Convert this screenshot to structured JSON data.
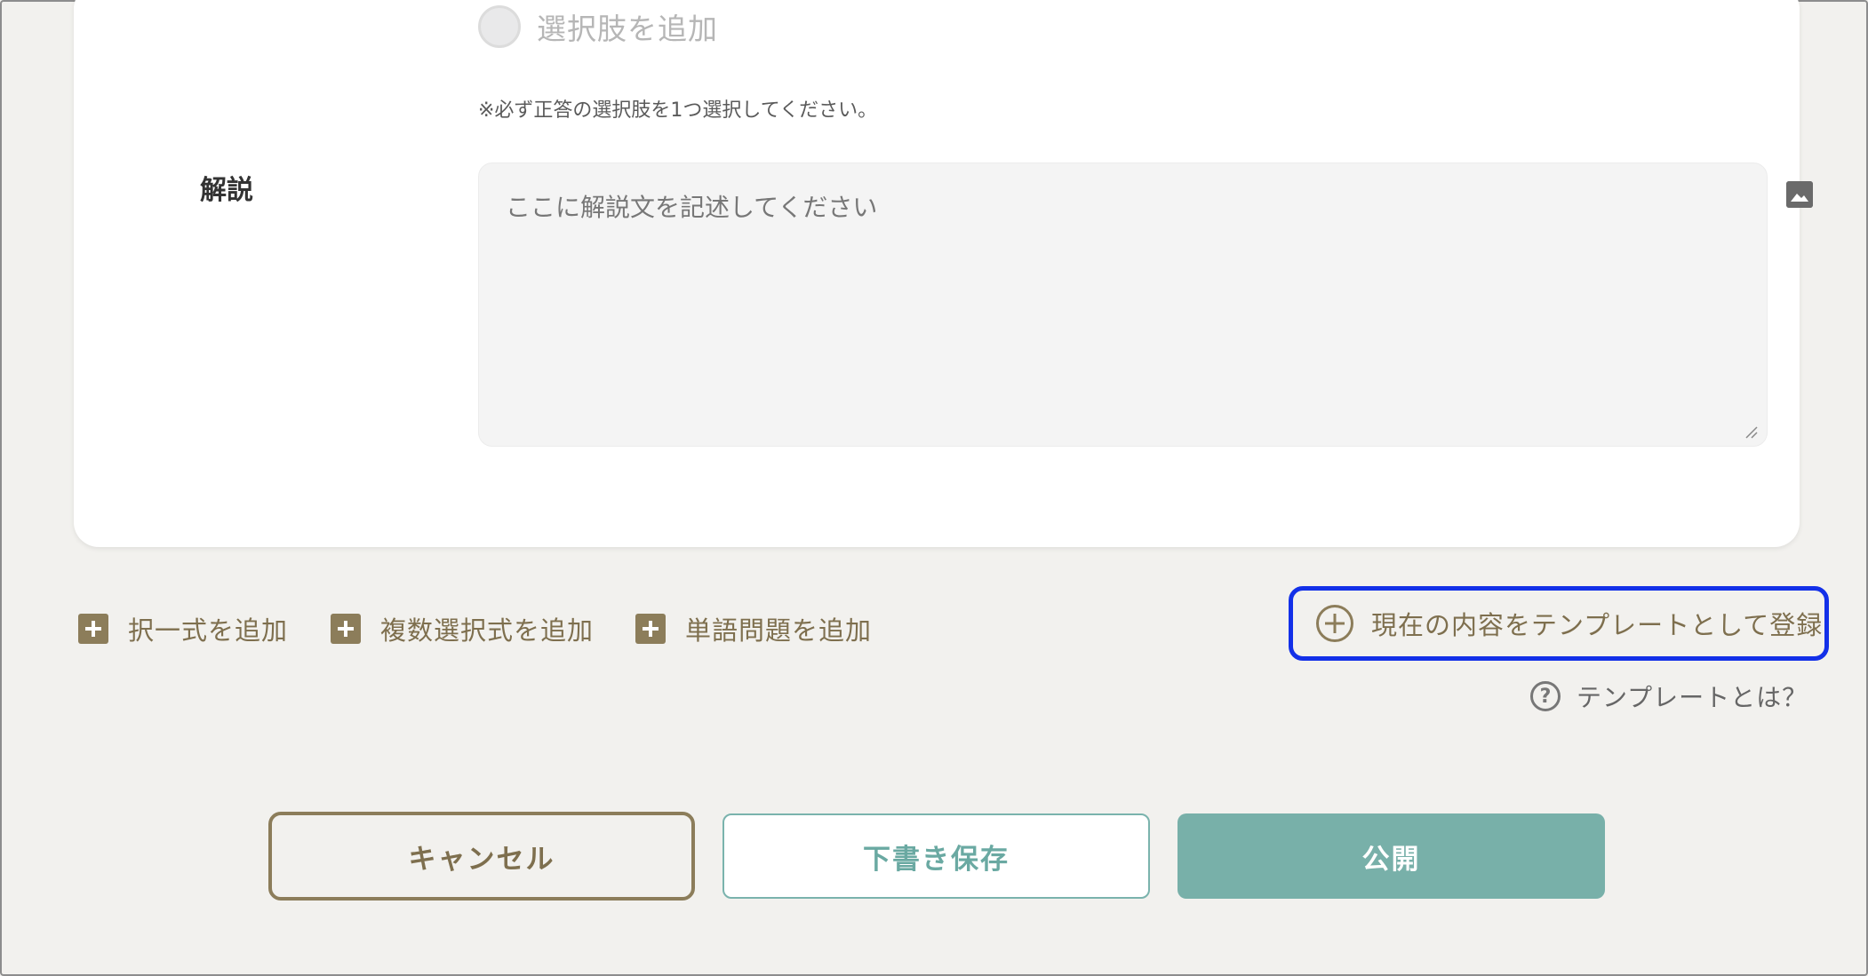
{
  "question": {
    "add_choice_label": "選択肢を追加",
    "note": "※必ず正答の選択肢を1つ選択してください。"
  },
  "explanation": {
    "label": "解説",
    "placeholder": "ここに解説文を記述してください"
  },
  "add_actions": [
    {
      "label": "択一式を追加",
      "icon": "plus-square-icon"
    },
    {
      "label": "複数選択式を追加",
      "icon": "plus-square-icon"
    },
    {
      "label": "単語問題を追加",
      "icon": "plus-square-icon"
    }
  ],
  "template": {
    "register_label": "現在の内容をテンプレートとして登録",
    "help_label": "テンプレートとは？",
    "help_icon_glyph": "?"
  },
  "buttons": {
    "cancel": "キャンセル",
    "draft": "下書き保存",
    "publish": "公開"
  },
  "colors": {
    "accent_olive": "#8c7d5a",
    "teal": "#78b0a9",
    "highlight_blue": "#1330e8"
  }
}
